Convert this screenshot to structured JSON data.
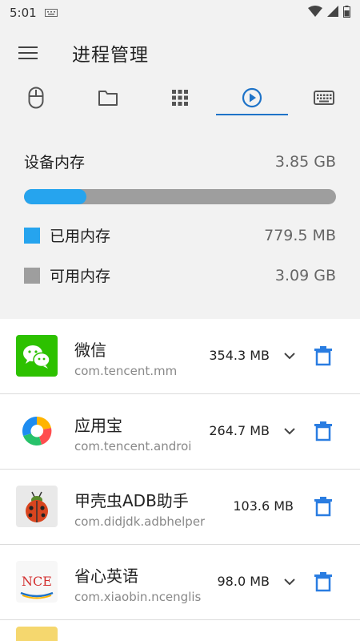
{
  "status_bar": {
    "time": "5:01"
  },
  "app_bar": {
    "title": "进程管理"
  },
  "tabs": [
    {
      "icon": "mouse-icon"
    },
    {
      "icon": "folder-icon"
    },
    {
      "icon": "apps-grid-icon"
    },
    {
      "icon": "play-circle-icon",
      "active": true
    },
    {
      "icon": "keyboard-icon"
    }
  ],
  "memory": {
    "title": "设备内存",
    "total": "3.85 GB",
    "used_label": "已用内存",
    "used_value": "779.5 MB",
    "free_label": "可用内存",
    "free_value": "3.09 GB",
    "used_fraction": 0.2,
    "colors": {
      "used": "#26a4ee",
      "free": "#9e9e9e"
    }
  },
  "processes": [
    {
      "name": "微信",
      "package": "com.tencent.mm",
      "size": "354.3 MB",
      "icon": "wechat-icon",
      "expandable": true
    },
    {
      "name": "应用宝",
      "package": "com.tencent.androi",
      "size": "264.7 MB",
      "icon": "yingyongbao-icon",
      "expandable": true
    },
    {
      "name": "甲壳虫ADB助手",
      "package": "com.didjdk.adbhelper",
      "size": "103.6 MB",
      "icon": "ladybug-icon",
      "expandable": false
    },
    {
      "name": "省心英语",
      "package": "com.xiaobin.ncenglis",
      "size": "98.0 MB",
      "icon": "nce-icon",
      "icon_text": "NCE",
      "expandable": true
    }
  ],
  "colors": {
    "accent": "#1e73c8",
    "trash": "#2a7de1"
  }
}
